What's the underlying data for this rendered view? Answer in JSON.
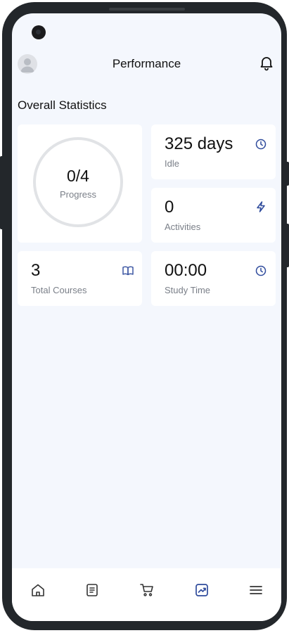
{
  "header": {
    "title": "Performance"
  },
  "section_title": "Overall Statistics",
  "progress": {
    "value": "0/4",
    "label": "Progress",
    "completed": 0,
    "total": 4
  },
  "idle": {
    "value": "325 days",
    "label": "Idle"
  },
  "activities": {
    "value": "0",
    "label": "Activities"
  },
  "courses": {
    "value": "3",
    "label": "Total Courses"
  },
  "study_time": {
    "value": "00:00",
    "label": "Study Time"
  },
  "colors": {
    "accent": "#2f4b9c",
    "background": "#f4f7fd",
    "card": "#ffffff",
    "ring": "#e1e3e6"
  },
  "icons": {
    "idle": "clock-icon",
    "activities": "lightning-icon",
    "courses": "book-icon",
    "study_time": "clock-icon",
    "nav": [
      "home-icon",
      "document-icon",
      "cart-icon",
      "chart-icon",
      "menu-icon"
    ]
  },
  "nav": {
    "active_index": 3
  }
}
